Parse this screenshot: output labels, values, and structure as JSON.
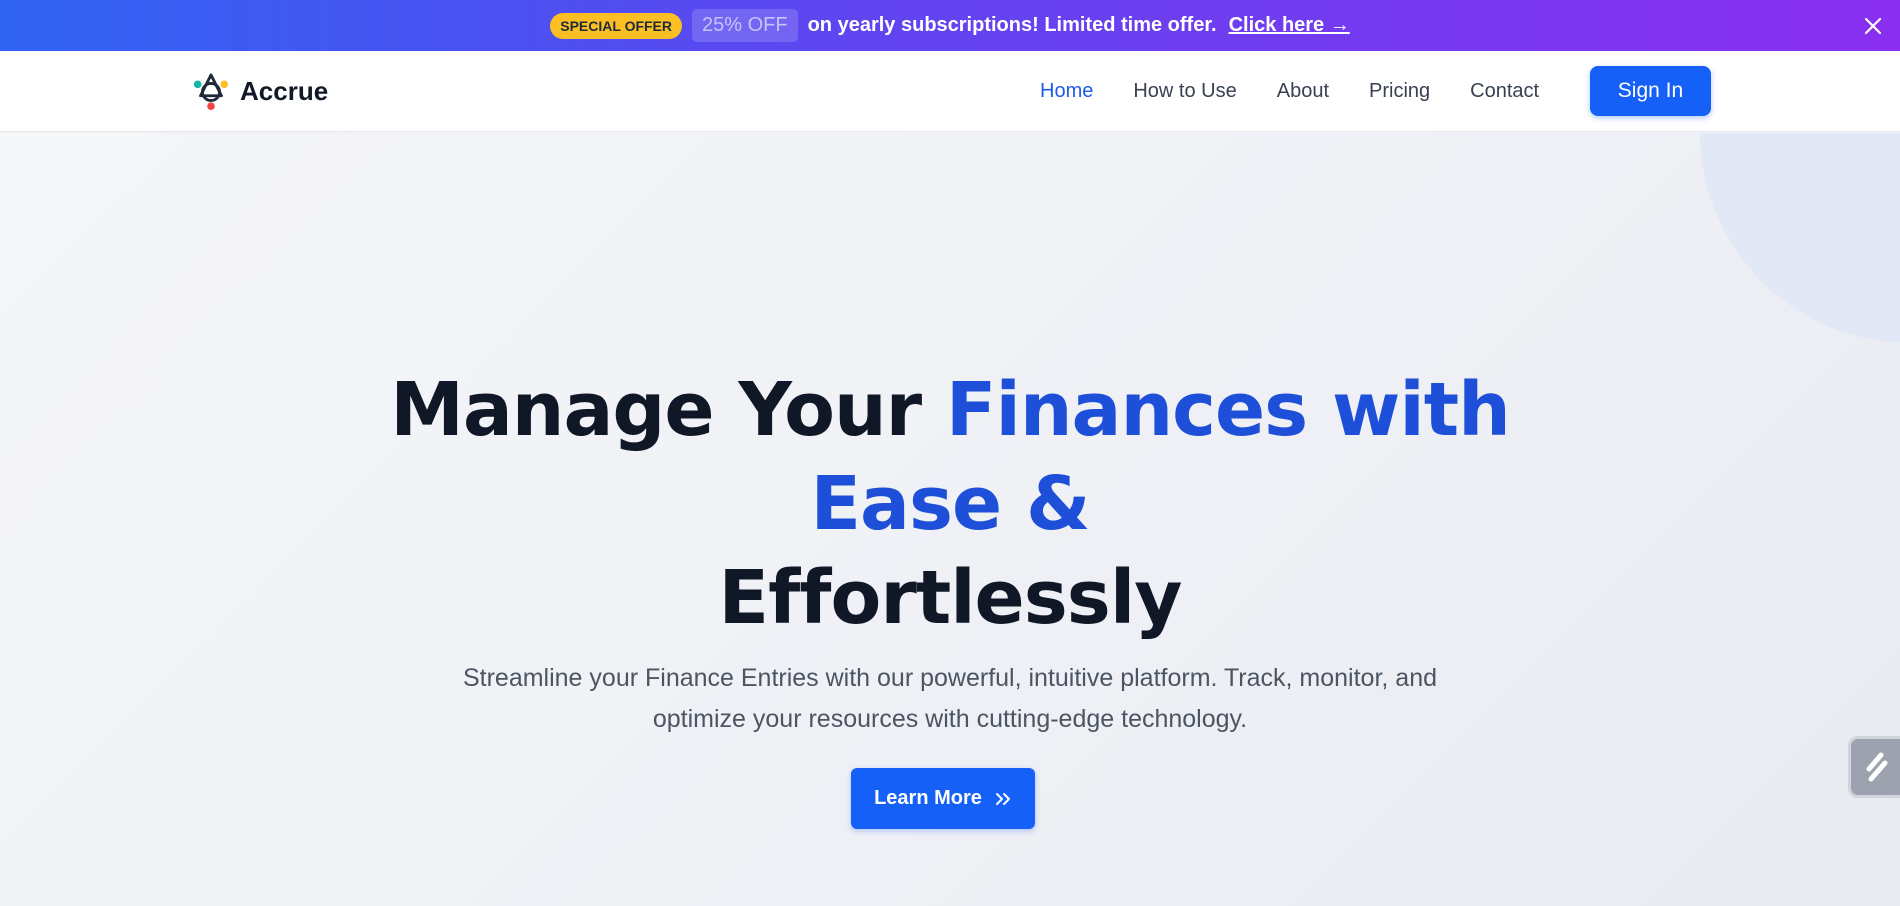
{
  "promo": {
    "special_label": "SPECIAL OFFER",
    "discount_label": "25% OFF",
    "message": "on yearly subscriptions! Limited time offer.",
    "link_label": "Click here →",
    "close_icon": "close-icon"
  },
  "nav": {
    "brand": "Accrue",
    "links": [
      {
        "label": "Home",
        "active": true
      },
      {
        "label": "How to Use",
        "active": false
      },
      {
        "label": "About",
        "active": false
      },
      {
        "label": "Pricing",
        "active": false
      },
      {
        "label": "Contact",
        "active": false
      }
    ],
    "signin_label": "Sign In"
  },
  "hero": {
    "headline_part1": "Manage Your ",
    "headline_part2": "Finances with",
    "headline_part3": "Ease &",
    "headline_part4": "Effortlessly",
    "subhead": "Streamline your Finance Entries with our powerful, intuitive platform. Track, monitor, and optimize your resources with cutting-edge technology.",
    "cta_label": "Learn More",
    "cta_icon": "double-chevron-right-icon"
  },
  "colors": {
    "accent": "#1560f6",
    "headline_blue": "#1d4fd8",
    "badge_yellow": "#fbbf24",
    "banner_start": "#2f63f2",
    "banner_end": "#8a2ff0"
  }
}
